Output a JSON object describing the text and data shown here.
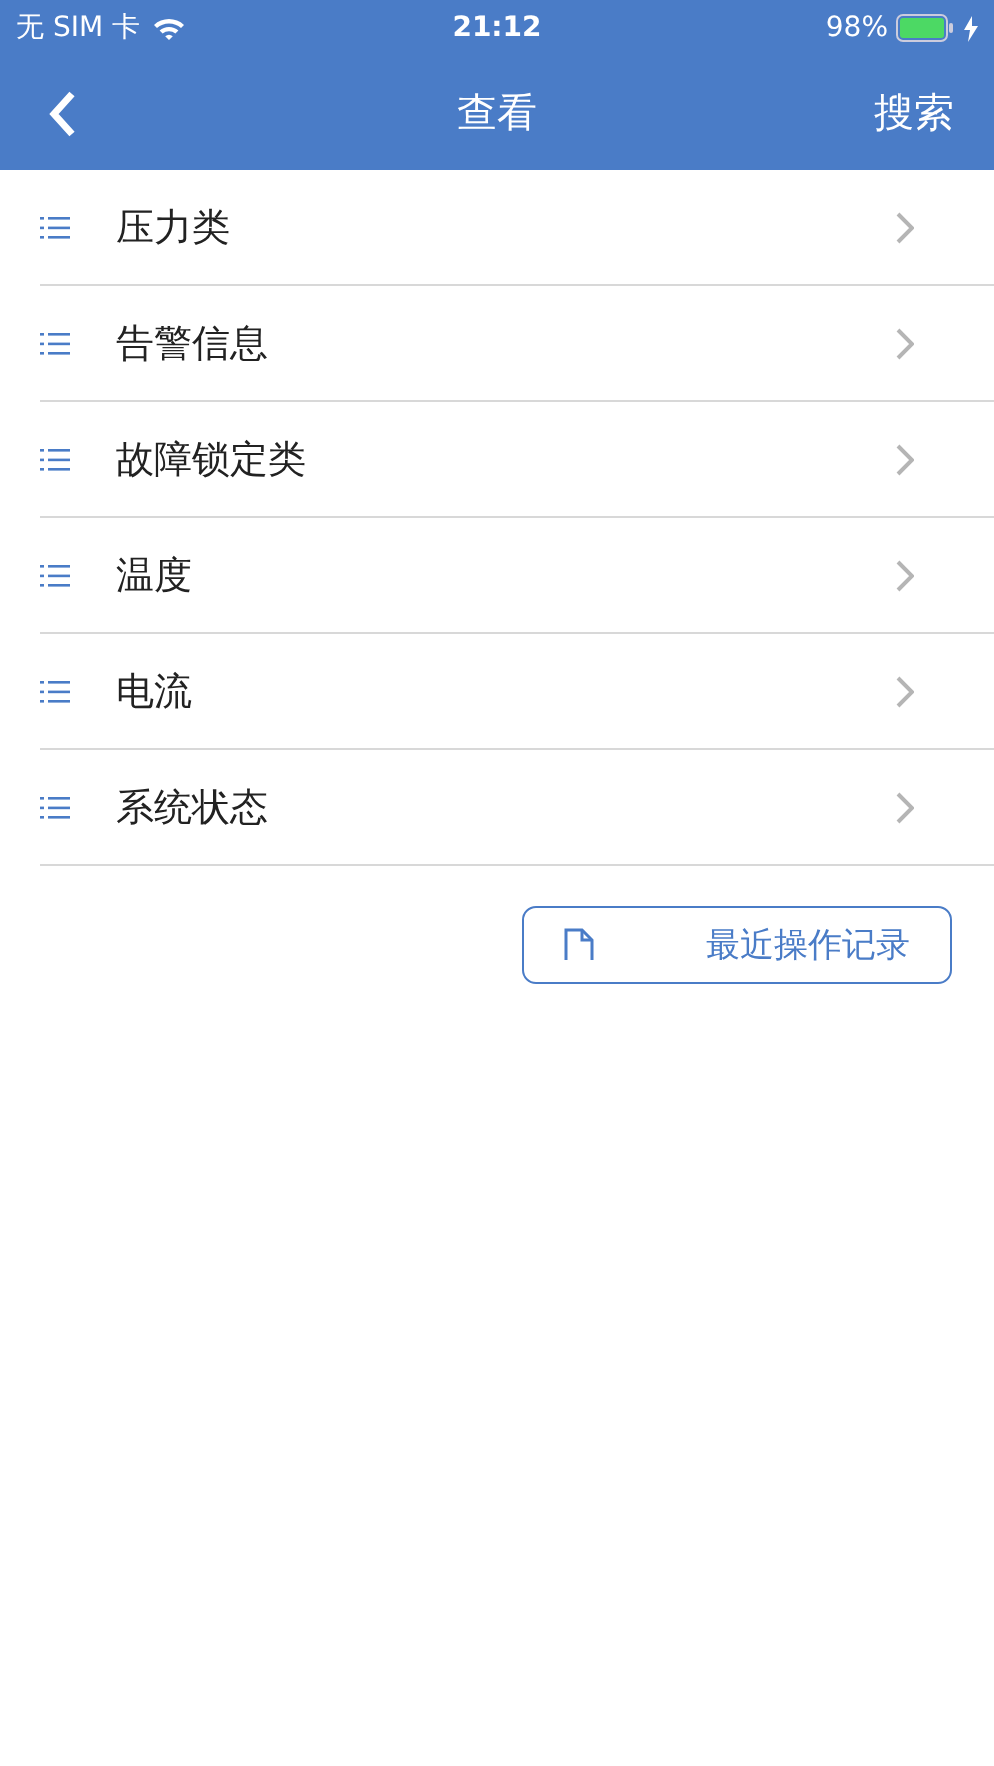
{
  "status_bar": {
    "carrier": "无 SIM 卡",
    "time": "21:12",
    "battery": "98%"
  },
  "nav_bar": {
    "title": "查看",
    "action": "搜索"
  },
  "menu": [
    {
      "label": "压力类"
    },
    {
      "label": "告警信息"
    },
    {
      "label": "故障锁定类"
    },
    {
      "label": "温度"
    },
    {
      "label": "电流"
    },
    {
      "label": "系统状态"
    }
  ],
  "history_button": {
    "label": "最近操作记录"
  }
}
